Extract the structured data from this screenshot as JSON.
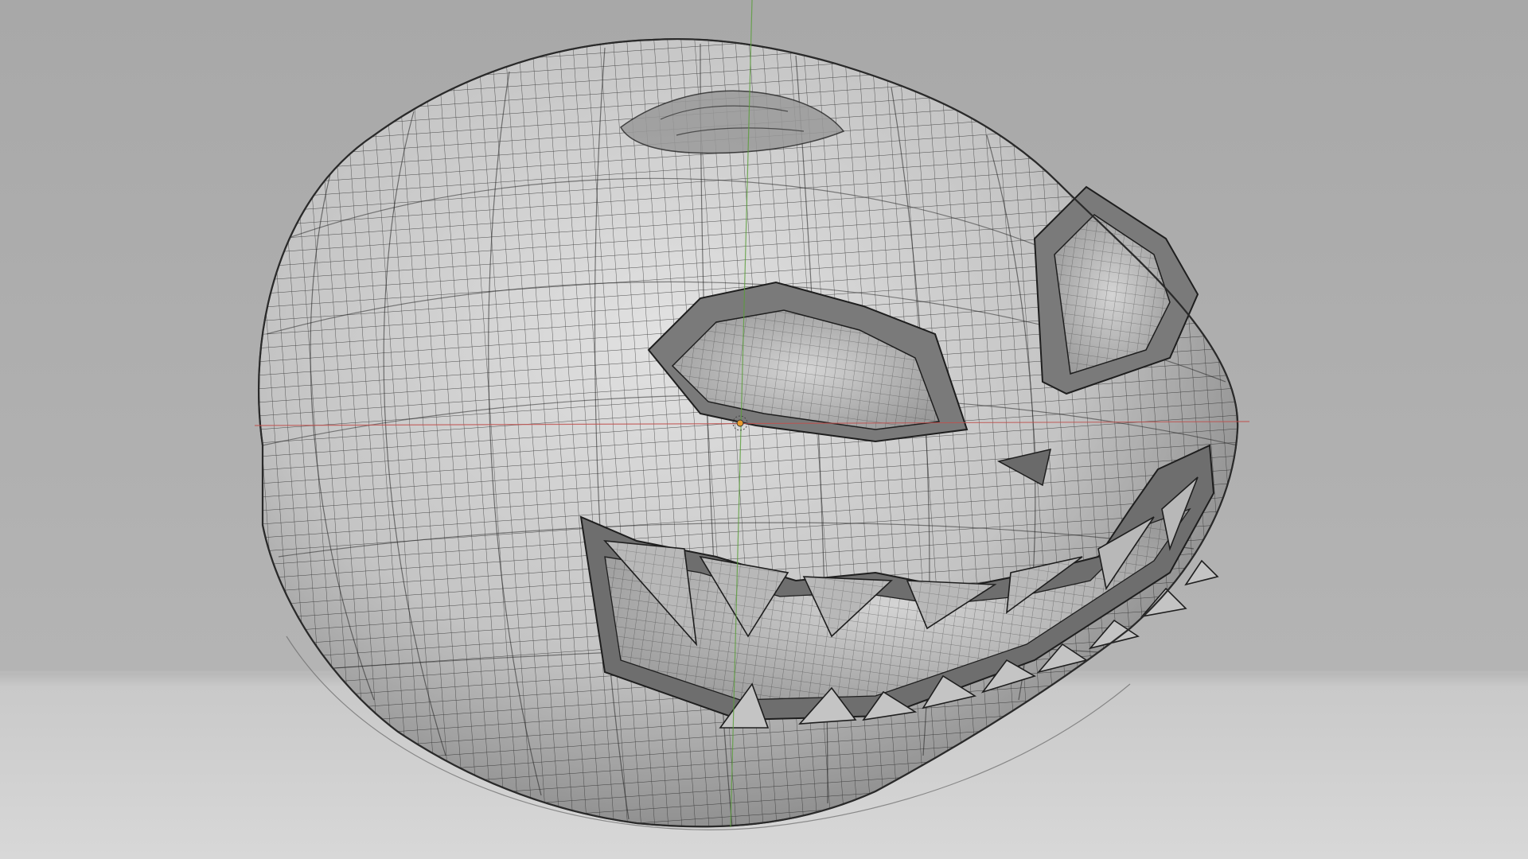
{
  "viewport": {
    "object_name": "",
    "mode": "",
    "shading": "wireframe-overlay",
    "subject": "pumpkin-mesh",
    "colors": {
      "background_top": "#a8a8a8",
      "background_bottom": "#d6d6d6",
      "mesh_fill": "#c9c9c9",
      "mesh_shadow": "#5a5a5a",
      "wire": "#1e1e1e",
      "x_axis": "#c0504d",
      "y_axis": "#5a9e3a",
      "origin": "#e89a2c"
    }
  }
}
